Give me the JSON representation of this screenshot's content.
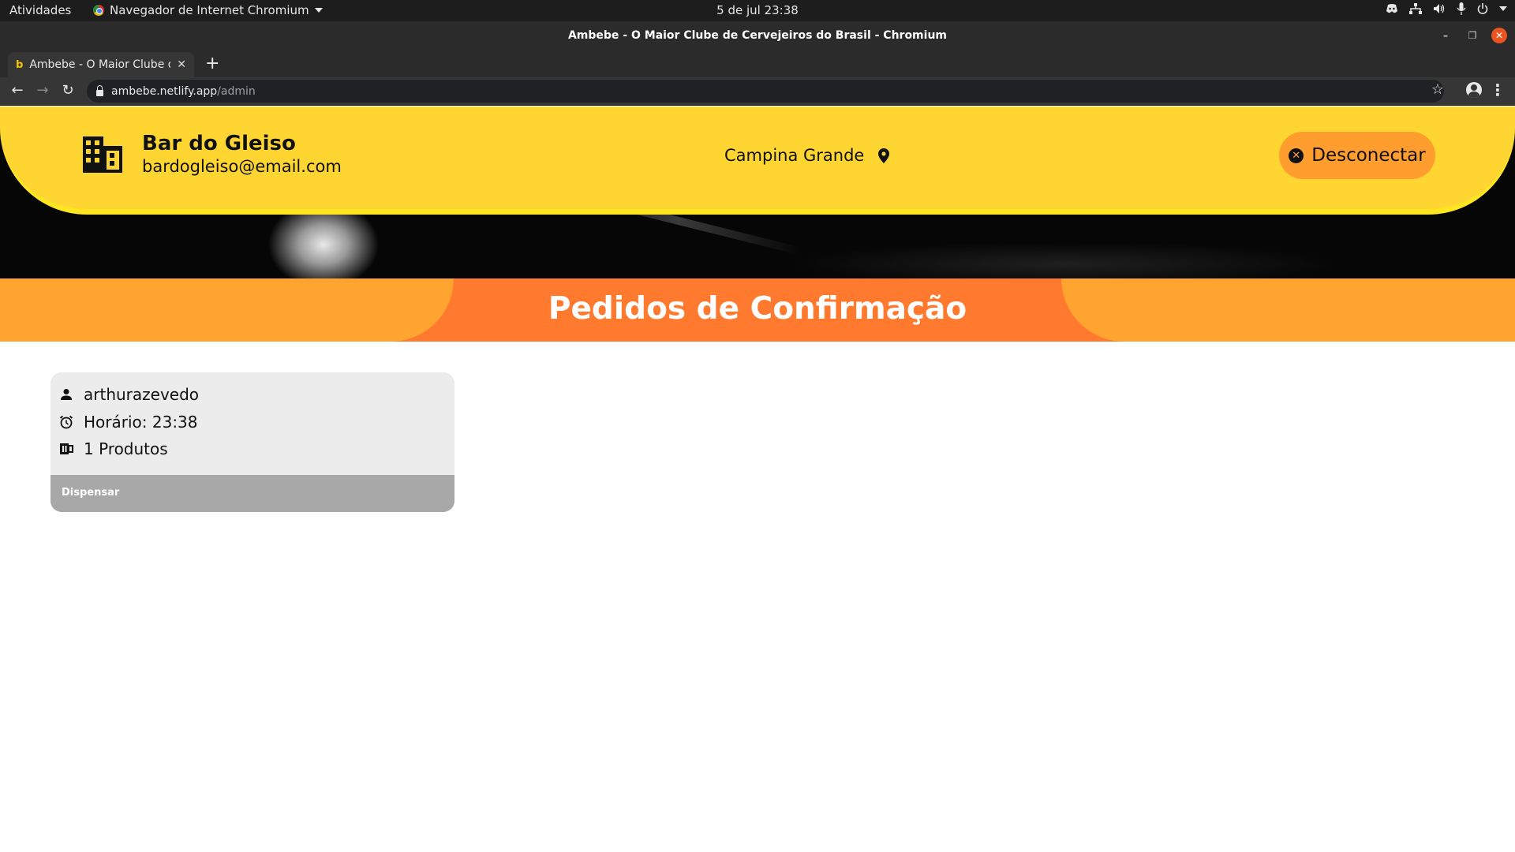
{
  "os": {
    "activities": "Atividades",
    "app_menu": "Navegador de Internet Chromium",
    "clock": "5 de jul  23:38"
  },
  "window": {
    "title": "Ambebe - O Maior Clube de Cervejeiros do Brasil - Chromium"
  },
  "browser": {
    "tab": {
      "favicon": "b",
      "title": "Ambebe - O Maior Clube de Cervejeiros do Brasil"
    },
    "url_host": "ambebe.netlify.app",
    "url_path": "/admin"
  },
  "header": {
    "bar_name": "Bar do Gleiso",
    "email": "bardogleiso@email.com",
    "city": "Campina Grande",
    "logout_label": "Desconectar"
  },
  "section": {
    "title": "Pedidos de Confirmação"
  },
  "orders": [
    {
      "username": "arthurazevedo",
      "time": "Horário: 23:38",
      "products": "1 Produtos",
      "dismiss_label": "Dispensar"
    }
  ],
  "colors": {
    "header_yellow": "#ffd531",
    "band_orange": "#ff7a2e",
    "band_light_orange": "#ffa42e",
    "button_orange": "#ff9d2e",
    "card_bg": "#ececec",
    "card_footer": "#a8a8a8"
  }
}
